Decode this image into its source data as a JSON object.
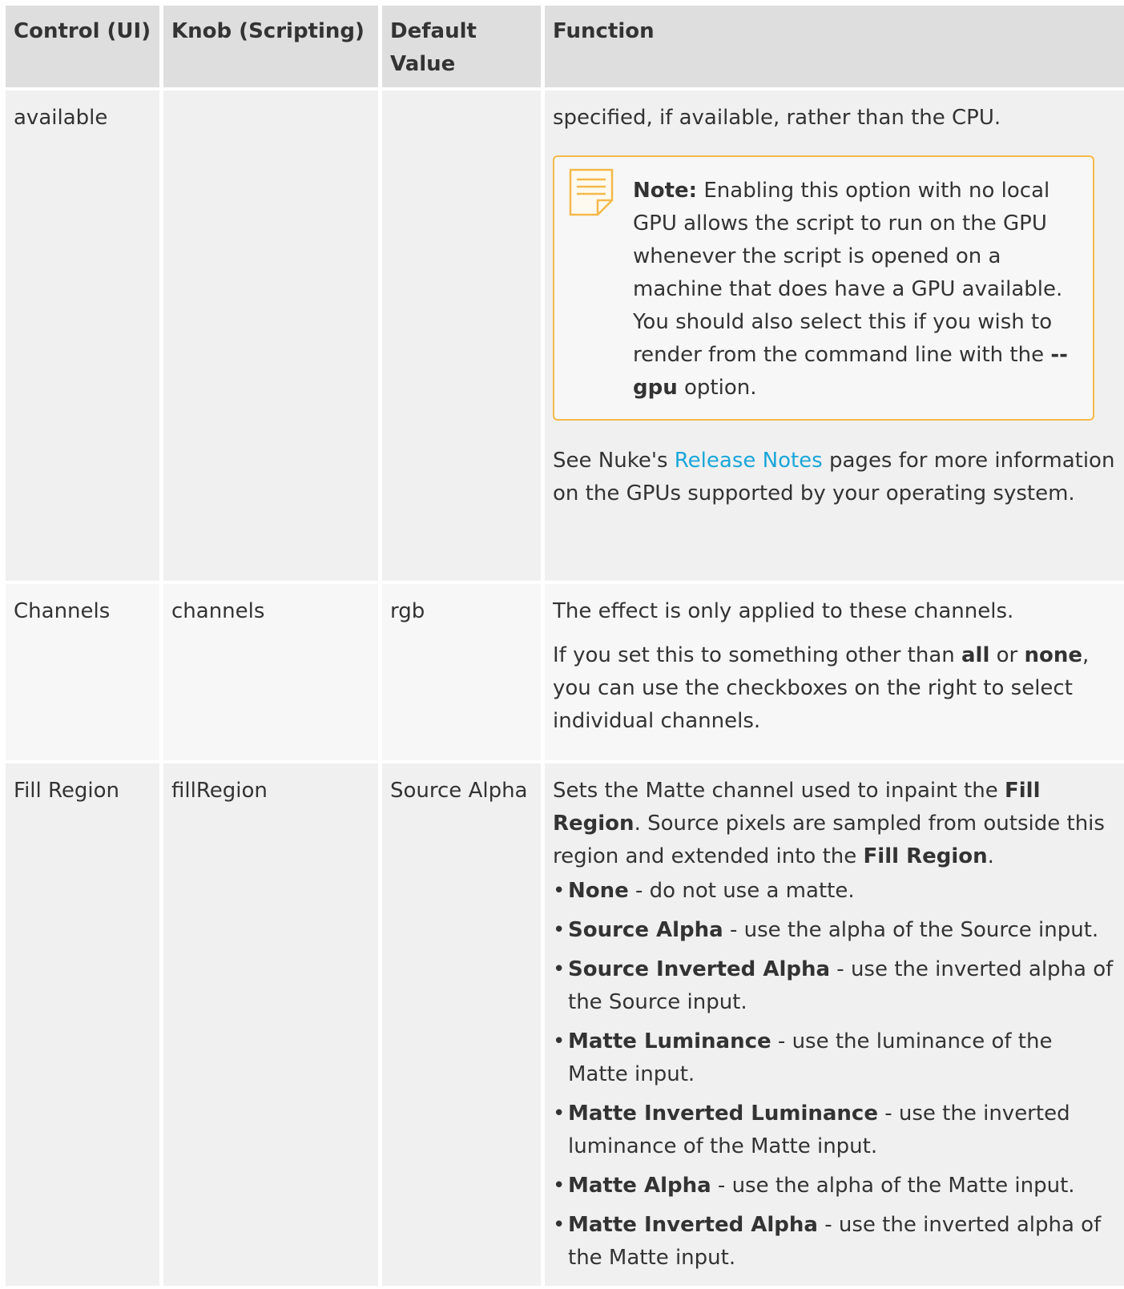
{
  "headers": {
    "control": "Control (UI)",
    "knob": "Knob (Scripting)",
    "default": "Default Value",
    "function": "Function"
  },
  "row_gpu": {
    "control": "available",
    "knob": "",
    "default": "",
    "intro": "specified, if available, rather than the CPU.",
    "note": {
      "label": "Note:",
      "text": " Enabling this option with no local GPU allows the script to run on the GPU whenever the script is opened on a machine that does have a GPU available. You should also select this if you wish to render from the command line with the ",
      "option": "--gpu",
      "text_end": " option."
    },
    "see_pre": "See Nuke's ",
    "see_link": "Release Notes",
    "see_post": " pages for more information on the GPUs supported by your operating system."
  },
  "row_channels": {
    "control": "Channels",
    "knob": "channels",
    "default": "rgb",
    "p1": "The effect is only applied to these channels.",
    "p2_a": "If you set this to something other than ",
    "p2_all": "all",
    "p2_or": " or ",
    "p2_none": "none",
    "p2_b": ", you can use the checkboxes on the right to select individual channels."
  },
  "row_fill": {
    "control": "Fill Region",
    "knob": "fillRegion",
    "default": "Source Alpha",
    "p_a": "Sets the Matte channel used to inpaint the ",
    "p_fill1": "Fill Region",
    "p_b": ". Source pixels are sampled from outside this region and extended into the ",
    "p_fill2": "Fill Region",
    "p_c": ".",
    "options": [
      {
        "name": "None",
        "desc": " - do not use a matte."
      },
      {
        "name": "Source Alpha",
        "desc": " - use the alpha of the Source input."
      },
      {
        "name": "Source Inverted Alpha",
        "desc": " - use the inverted alpha of the Source input."
      },
      {
        "name": "Matte Luminance",
        "desc": " - use the luminance of the Matte input."
      },
      {
        "name": "Matte Inverted Luminance",
        "desc": " - use the inverted luminance of the Matte input."
      },
      {
        "name": "Matte Alpha",
        "desc": " - use the alpha of the Matte input."
      },
      {
        "name": "Matte Inverted Alpha",
        "desc": " - use the inverted alpha of the Matte input."
      }
    ]
  },
  "colors": {
    "header_bg": "#dedede",
    "row_bg": "#f0f0f0",
    "row_alt_bg": "#f7f7f7",
    "note_border": "#f5b94a",
    "link": "#1aa6d9"
  },
  "icons": {
    "note": "note-icon"
  }
}
